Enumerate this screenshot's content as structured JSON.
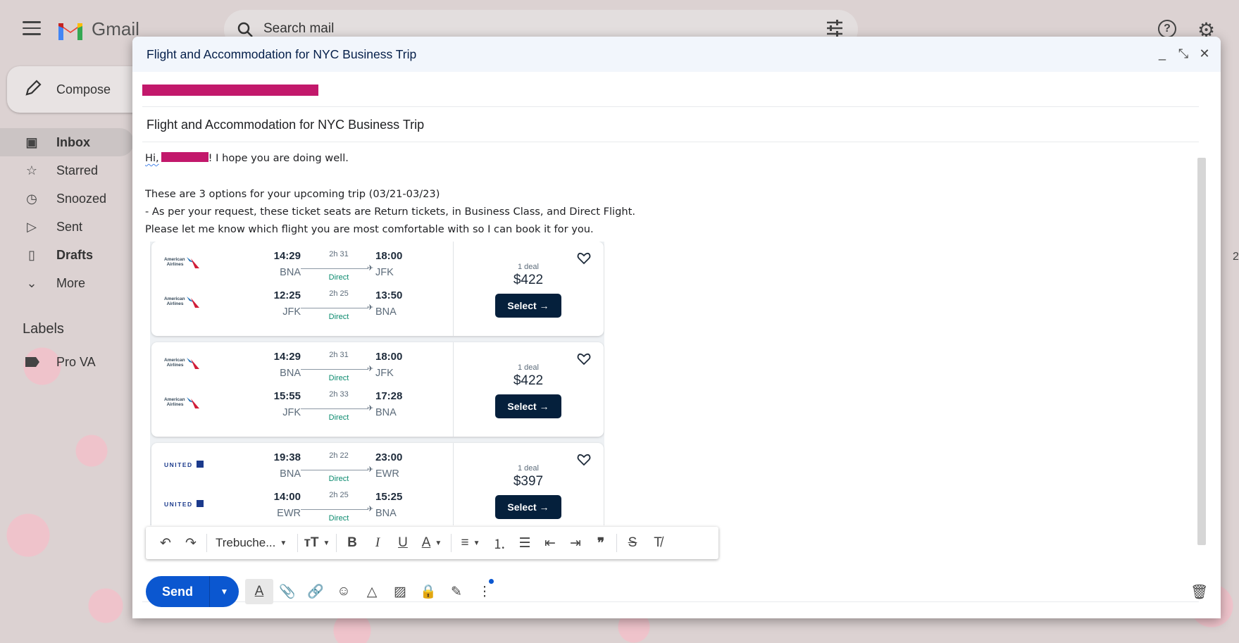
{
  "app": {
    "name": "Gmail",
    "search_placeholder": "Search mail"
  },
  "sidebar": {
    "compose_label": "Compose",
    "items": [
      {
        "label": "Inbox",
        "icon": "inbox-icon"
      },
      {
        "label": "Starred",
        "icon": "star-icon"
      },
      {
        "label": "Snoozed",
        "icon": "clock-icon"
      },
      {
        "label": "Sent",
        "icon": "send-icon"
      },
      {
        "label": "Drafts",
        "icon": "draft-icon"
      },
      {
        "label": "More",
        "icon": "chevron-down-icon"
      }
    ],
    "labels_title": "Labels",
    "labels": [
      {
        "label": "Pro VA",
        "icon": "label-icon"
      }
    ]
  },
  "compose": {
    "window_title": "Flight and Accommodation for NYC Business Trip",
    "subject": "Flight and Accommodation for NYC Business Trip",
    "body": {
      "greeting_hi": "Hi,",
      "greeting_rest": "! I hope you are doing well.",
      "line1": "These are 3 options for your upcoming trip (03/21-03/23)",
      "line2": "- As per your request, these ticket seats are Return tickets, in Business Class, and Direct Flight.",
      "line3": "Please let me know which flight you are most comfortable with so I can book it for you."
    },
    "font_name": "Trebuche...",
    "send_label": "Send"
  },
  "flights": [
    {
      "airline": "American Airlines",
      "legs": [
        {
          "dep_time": "14:29",
          "dep_code": "BNA",
          "duration": "2h 31",
          "stops": "Direct",
          "arr_time": "18:00",
          "arr_code": "JFK"
        },
        {
          "dep_time": "12:25",
          "dep_code": "JFK",
          "duration": "2h 25",
          "stops": "Direct",
          "arr_time": "13:50",
          "arr_code": "BNA"
        }
      ],
      "deal": "1 deal",
      "price": "$422",
      "select_label": "Select →"
    },
    {
      "airline": "American Airlines",
      "legs": [
        {
          "dep_time": "14:29",
          "dep_code": "BNA",
          "duration": "2h 31",
          "stops": "Direct",
          "arr_time": "18:00",
          "arr_code": "JFK"
        },
        {
          "dep_time": "15:55",
          "dep_code": "JFK",
          "duration": "2h 33",
          "stops": "Direct",
          "arr_time": "17:28",
          "arr_code": "BNA"
        }
      ],
      "deal": "1 deal",
      "price": "$422",
      "select_label": "Select →"
    },
    {
      "airline": "UNITED",
      "legs": [
        {
          "dep_time": "19:38",
          "dep_code": "BNA",
          "duration": "2h 22",
          "stops": "Direct",
          "arr_time": "23:00",
          "arr_code": "EWR"
        },
        {
          "dep_time": "14:00",
          "dep_code": "EWR",
          "duration": "2h 25",
          "stops": "Direct",
          "arr_time": "15:25",
          "arr_code": "BNA"
        }
      ],
      "deal": "1 deal",
      "price": "$397",
      "select_label": "Select →"
    }
  ],
  "colors": {
    "accent": "#0b57d0",
    "redaction": "#c2186b",
    "select_button": "#05203c",
    "direct_green": "#0a8a6e"
  }
}
